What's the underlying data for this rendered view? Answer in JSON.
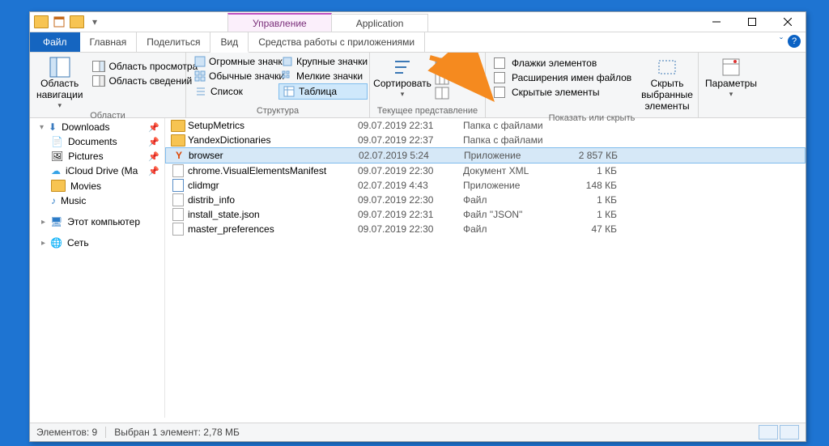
{
  "titlebar": {
    "manage_tab": "Управление",
    "app_tab": "Application"
  },
  "ribbon_tabs": {
    "file": "Файл",
    "home": "Главная",
    "share": "Поделиться",
    "view": "Вид",
    "apptools": "Средства работы с приложениями"
  },
  "ribbon": {
    "panes": {
      "nav": "Область навигации",
      "preview": "Область просмотра",
      "details": "Область сведений",
      "group": "Области"
    },
    "layout": {
      "huge": "Огромные значки",
      "large": "Крупные значки",
      "normal": "Обычные значки",
      "small": "Мелкие значки",
      "list": "Список",
      "details": "Таблица",
      "group": "Структура"
    },
    "currentview": {
      "sort": "Сортировать",
      "group": "Текущее представление"
    },
    "showhide": {
      "checkboxes": "Флажки элементов",
      "extensions": "Расширения имен файлов",
      "hidden": "Скрытые элементы",
      "hide_selected": "Скрыть выбранные элементы",
      "group": "Показать или скрыть"
    },
    "options": "Параметры"
  },
  "nav": {
    "downloads": "Downloads",
    "documents": "Documents",
    "pictures": "Pictures",
    "icloud": "iCloud Drive (Ma",
    "movies": "Movies",
    "music": "Music",
    "thispc": "Этот компьютер",
    "network": "Сеть"
  },
  "files": [
    {
      "icon": "folder",
      "name": "SetupMetrics",
      "date": "09.07.2019 22:31",
      "type": "Папка с файлами",
      "size": ""
    },
    {
      "icon": "folder",
      "name": "YandexDictionaries",
      "date": "09.07.2019 22:37",
      "type": "Папка с файлами",
      "size": ""
    },
    {
      "icon": "yandex",
      "name": "browser",
      "date": "02.07.2019 5:24",
      "type": "Приложение",
      "size": "2 857 КБ",
      "selected": true
    },
    {
      "icon": "xml",
      "name": "chrome.VisualElementsManifest",
      "date": "09.07.2019 22:30",
      "type": "Документ XML",
      "size": "1 КБ"
    },
    {
      "icon": "exe",
      "name": "clidmgr",
      "date": "02.07.2019 4:43",
      "type": "Приложение",
      "size": "148 КБ"
    },
    {
      "icon": "file",
      "name": "distrib_info",
      "date": "09.07.2019 22:30",
      "type": "Файл",
      "size": "1 КБ"
    },
    {
      "icon": "file",
      "name": "install_state.json",
      "date": "09.07.2019 22:31",
      "type": "Файл \"JSON\"",
      "size": "1 КБ"
    },
    {
      "icon": "file",
      "name": "master_preferences",
      "date": "09.07.2019 22:30",
      "type": "Файл",
      "size": "47 КБ"
    }
  ],
  "status": {
    "count": "Элементов: 9",
    "selection": "Выбран 1 элемент: 2,78 МБ"
  }
}
